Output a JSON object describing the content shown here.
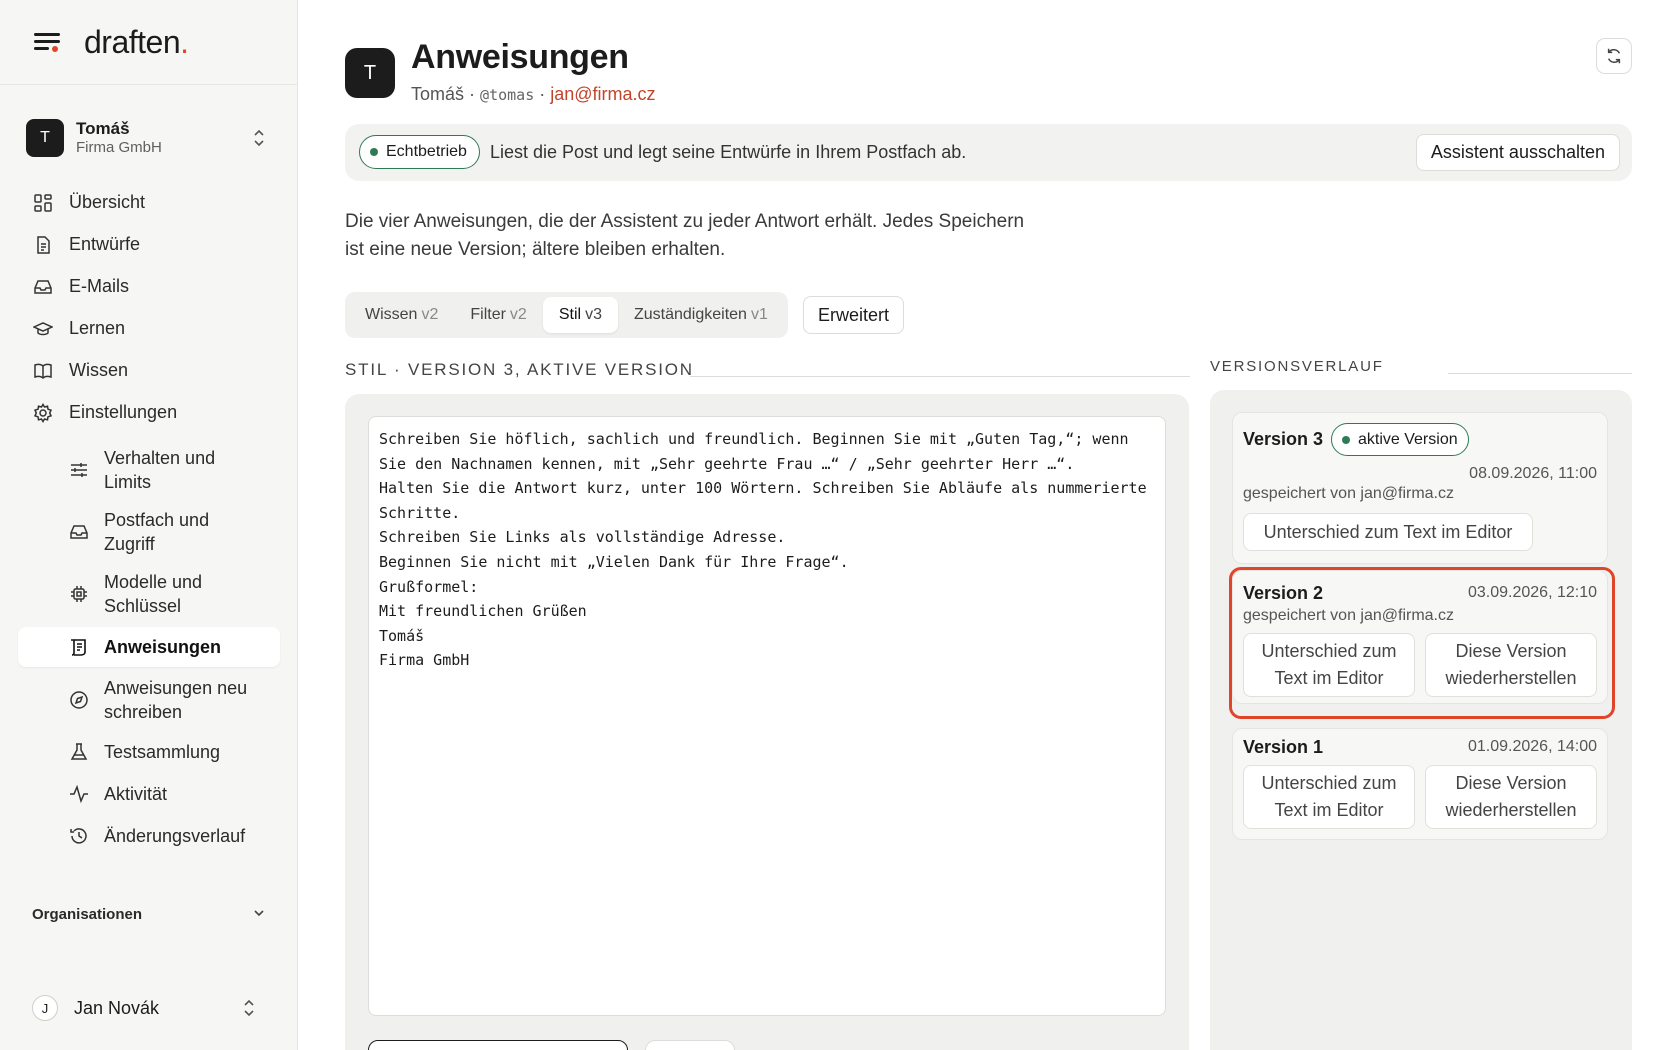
{
  "brand": {
    "logo": "draften",
    "logo_dot": "."
  },
  "account": {
    "initial": "T",
    "name": "Tomáš",
    "org": "Firma GmbH"
  },
  "nav": {
    "overview": "Übersicht",
    "drafts": "Entwürfe",
    "emails": "E-Mails",
    "learn": "Lernen",
    "knowledge": "Wissen",
    "settings": "Einstellungen",
    "sub": {
      "behavior": "Verhalten und Limits",
      "mailbox": "Postfach und Zugriff",
      "models": "Modelle und Schlüssel",
      "instructions": "Anweisungen",
      "rewrite": "Anweisungen neu schreiben",
      "tests": "Testsammlung",
      "activity": "Aktivität",
      "history": "Änderungsverlauf"
    },
    "organisations": "Organisationen"
  },
  "user": {
    "initial": "J",
    "name": "Jan Novák"
  },
  "page": {
    "avatar": "T",
    "title": "Anweisungen",
    "sub_name": "Tomáš",
    "sep": "·",
    "handle": "@tomas",
    "email": "jan@firma.cz"
  },
  "banner": {
    "badge": "Echtbetrieb",
    "text": "Liest die Post und legt seine Entwürfe in Ihrem Postfach ab.",
    "button": "Assistent ausschalten"
  },
  "intro": "Die vier Anweisungen, die der Assistent zu jeder Antwort erhält. Jedes Speichern ist eine neue Version; ältere bleiben erhalten.",
  "tabs": [
    {
      "label": "Wissen",
      "version": "v2"
    },
    {
      "label": "Filter",
      "version": "v2"
    },
    {
      "label": "Stil",
      "version": "v3"
    },
    {
      "label": "Zuständigkeiten",
      "version": "v1"
    }
  ],
  "advanced_button": "Erweitert",
  "section_title": "STIL · VERSION 3, AKTIVE VERSION",
  "editor_text": "Schreiben Sie höflich, sachlich und freundlich. Beginnen Sie mit „Guten Tag,“; wenn\nSie den Nachnamen kennen, mit „Sehr geehrte Frau …“ / „Sehr geehrter Herr …“.\nHalten Sie die Antwort kurz, unter 100 Wörtern. Schreiben Sie Abläufe als nummerierte\nSchritte.\nSchreiben Sie Links als vollständige Adresse.\nBeginnen Sie nicht mit „Vielen Dank für Ihre Frage“.\nGrußformel:\nMit freundlichen Grüßen\nTomáš\nFirma GmbH",
  "history": {
    "title": "VERSIONSVERLAUF",
    "versions": [
      {
        "name": "Version 3",
        "badge": "aktive Version",
        "date": "08.09.2026, 11:00",
        "by": "gespeichert von jan@firma.cz",
        "diff": "Unterschied zum Text im Editor"
      },
      {
        "name": "Version 2",
        "date": "03.09.2026, 12:10",
        "by": "gespeichert von jan@firma.cz",
        "diff": "Unterschied zum Text im Editor",
        "restore": "Diese Version wiederherstellen"
      },
      {
        "name": "Version 1",
        "date": "01.09.2026, 14:00",
        "diff": "Unterschied zum Text im Editor",
        "restore": "Diese Version wiederherstellen"
      }
    ]
  },
  "colors": {
    "accent": "#e0452a",
    "green": "#2f7a55",
    "email_link": "#c0452b"
  },
  "icons": [
    "menu-icon",
    "grid-icon",
    "document-icon",
    "inbox-icon",
    "graduation-cap-icon",
    "book-icon",
    "gear-icon",
    "sliders-icon",
    "inbox-icon",
    "chip-icon",
    "scroll-icon",
    "compass-icon",
    "flask-icon",
    "activity-icon",
    "history-icon",
    "chevron-down-icon",
    "chevron-updown-icon",
    "refresh-icon"
  ]
}
